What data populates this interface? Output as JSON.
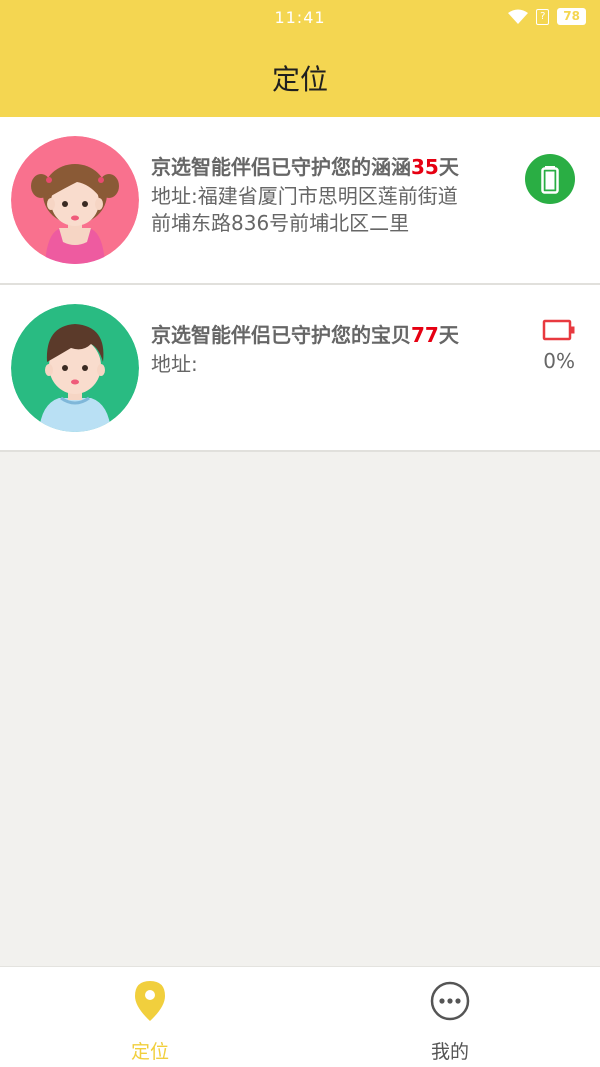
{
  "status_bar": {
    "time": "11:41",
    "battery": "78"
  },
  "header": {
    "title": "定位"
  },
  "devices": [
    {
      "headline_prefix": "京选智能伴侣已守护您的涵涵",
      "days": "35",
      "headline_suffix": "天",
      "address_line1": "地址:福建省厦门市思明区莲前街道",
      "address_line2": "前埔东路836号前埔北区二里",
      "avatar": "girl-avatar",
      "avatar_bg": "#f9718e",
      "battery_icon": "battery-full-icon",
      "battery_color": "#2aae44"
    },
    {
      "headline_prefix": "京选智能伴侣已守护您的宝贝",
      "days": "77",
      "headline_suffix": "天",
      "address_line1": "地址:",
      "address_line2": "",
      "avatar": "boy-avatar",
      "avatar_bg": "#29bb82",
      "battery_icon": "battery-empty-icon",
      "battery_percent": "0%",
      "battery_color": "#e8393f"
    }
  ],
  "tabbar": {
    "tabs": [
      {
        "label": "定位",
        "icon": "location-pin-icon",
        "active": true,
        "color": "#f1cf3d"
      },
      {
        "label": "我的",
        "icon": "more-circle-icon",
        "active": false,
        "color": "#555555"
      }
    ]
  }
}
